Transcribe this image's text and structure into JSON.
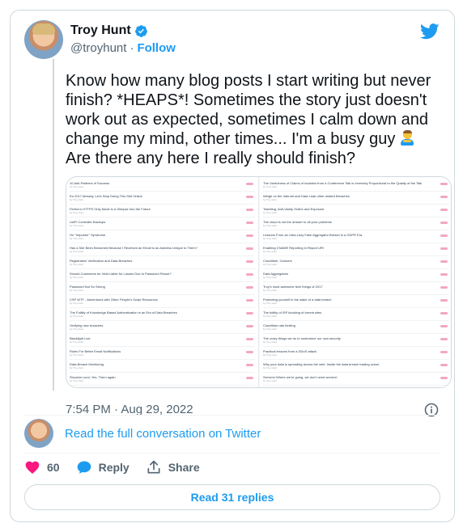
{
  "author": {
    "name": "Troy Hunt",
    "handle": "@troyhunt",
    "follow_label": "Follow"
  },
  "tweet": {
    "text": "Know how many blog posts I start writing but never finish? *HEAPS*! Sometimes the story just doesn't work out as expected, sometimes I calm down and change my mind, other times... I'm a busy guy ",
    "text_after_emoji": "\nAre there any here I really should finish?",
    "timestamp": "7:54 PM · Aug 29, 2022"
  },
  "media": {
    "left_posts": [
      {
        "title": "10 Anti-Patterns of Success",
        "date": "by Troy Hunt"
      },
      {
        "title": "It's 2017 Already, Let's Stop Doing This Shit Online",
        "date": "by Troy Hunt"
      },
      {
        "title": "Firefox's HTTPS Only Mode is a Glimpse Into the Future",
        "date": "by Troy Hunt"
      },
      {
        "title": "UniFi Controller Backups",
        "date": "by Troy Hunt"
      },
      {
        "title": "On \"Impostor\" Syndrome",
        "date": "by Troy Hunt"
      },
      {
        "title": "Has a Site Been Breached Because I Received an Email to an Address Unique to Them?",
        "date": "by Troy Hunt"
      },
      {
        "title": "Registration Verification and Data Breaches",
        "date": "by Troy Hunt"
      },
      {
        "title": "Should Customers be Held Liable for Losses Due to Password Reuse?",
        "date": "by Troy Hunt"
      },
      {
        "title": "Password Not So Strong",
        "date": "by Troy Hunt"
      },
      {
        "title": "CSP WTF - Adventures with Other People's Script Resources",
        "date": "by Troy Hunt"
      },
      {
        "title": "The Futility of Knowledge Based Authentication in an Era of Data Breaches",
        "date": "by Troy Hunt"
      },
      {
        "title": "Verifying new breaches",
        "date": "by Troy Hunt"
      },
      {
        "title": "Blacklight Live",
        "date": "by Troy Hunt"
      },
      {
        "title": "Rules For Better Email Notifications",
        "date": "by Troy Hunt"
      },
      {
        "title": "Data Breach Monitoring",
        "date": "by Troy Hunt"
      },
      {
        "title": "Shoulda Lund, Yes, Them again",
        "date": "by Troy Hunt"
      },
      {
        "title": "5 things developers can do to start doing today to take control of their career",
        "date": "by Troy Hunt"
      }
    ],
    "right_posts": [
      {
        "title": "The Usefulness of Claims of Isolation from a Conference Talk is Inversely Proportional to the Quality of the Talk",
        "date": "by Troy Hunt"
      },
      {
        "title": "Weigh on the Internet and Data Leak other related Breaches",
        "date": "by Troy Hunt"
      },
      {
        "title": "Tweeting, Anti-Vanity Online and Exposure",
        "date": "by Troy Hunt"
      },
      {
        "title": "The cloud is not the answer to all your problems",
        "date": "by Troy Hunt"
      },
      {
        "title": "Lessons From an Ultra-Lazy Fake Aggregator Breach in a GDPR Era",
        "date": "by Troy Hunt"
      },
      {
        "title": "Enabling CNAME Reporting in Report URI",
        "date": "by Troy Hunt"
      },
      {
        "title": "Cloudflare, Gunners",
        "date": "by Troy Hunt"
      },
      {
        "title": "Data Aggregators",
        "date": "by Troy Hunt"
      },
      {
        "title": "Troy's most awesome tech things of 2017",
        "date": "by Troy Hunt"
      },
      {
        "title": "Protecting yourself in the wake of a data breach",
        "date": "by Troy Hunt"
      },
      {
        "title": "The futility of ISP blocking of torrent sites",
        "date": "by Troy Hunt"
      },
      {
        "title": "Cloudflare rate limiting",
        "date": "by Troy Hunt"
      },
      {
        "title": "The crazy things we do to undermine our own security",
        "date": "by Troy Hunt"
      },
      {
        "title": "Practical lessons from a DDoS attack",
        "date": "by Troy Hunt"
      },
      {
        "title": "Why your data is spreading across the web: Inside the data breach trading scene",
        "date": "by Troy Hunt"
      },
      {
        "title": "Servers! Where we're going, we don't need servers!",
        "date": "by Troy Hunt"
      },
      {
        "title": "Breach notification and guidance: here's what not to do",
        "date": "by Troy Hunt"
      }
    ]
  },
  "read_full_label": "Read the full conversation on Twitter",
  "actions": {
    "likes_count": "60",
    "reply_label": "Reply",
    "share_label": "Share"
  },
  "read_replies_label": "Read 31 replies",
  "colors": {
    "accent": "#1d9bf0",
    "like": "#f91880",
    "secondary_text": "#536471",
    "border": "#cfd9de"
  }
}
